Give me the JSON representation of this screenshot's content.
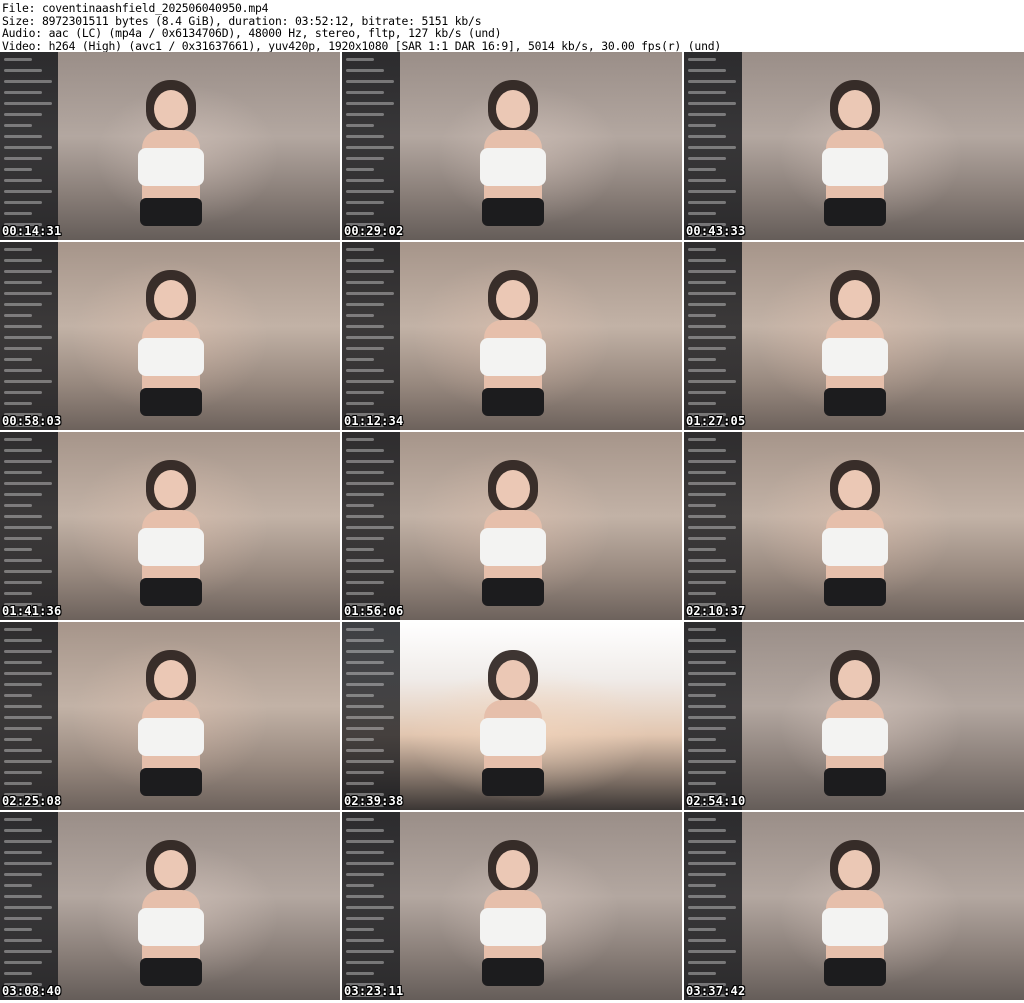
{
  "header": {
    "file_line": "File: coventinaashfield_202506040950.mp4",
    "size_line": "Size: 8972301511 bytes (8.4 GiB), duration: 03:52:12, bitrate: 5151 kb/s",
    "audio_line": "Audio: aac (LC) (mp4a / 0x6134706D), 48000 Hz, stereo, fltp, 127 kb/s (und)",
    "video_line": "Video: h264 (High) (avc1 / 0x31637661), yuv420p, 1920x1080 [SAR 1:1 DAR 16:9], 5014 kb/s, 30.00 fps(r) (und)"
  },
  "thumbnails": [
    {
      "time": "00:14:31",
      "variant": "alt",
      "overlay": true
    },
    {
      "time": "00:29:02",
      "variant": "alt",
      "overlay": true
    },
    {
      "time": "00:43:33",
      "variant": "alt",
      "overlay": true
    },
    {
      "time": "00:58:03",
      "variant": "warm",
      "overlay": true
    },
    {
      "time": "01:12:34",
      "variant": "warm",
      "overlay": true
    },
    {
      "time": "01:27:05",
      "variant": "warm",
      "overlay": true
    },
    {
      "time": "01:41:36",
      "variant": "warm",
      "overlay": true
    },
    {
      "time": "01:56:06",
      "variant": "warm",
      "overlay": true
    },
    {
      "time": "02:10:37",
      "variant": "warm",
      "overlay": true
    },
    {
      "time": "02:25:08",
      "variant": "warm",
      "overlay": true
    },
    {
      "time": "02:39:38",
      "variant": "close",
      "overlay": true
    },
    {
      "time": "02:54:10",
      "variant": "alt",
      "overlay": true
    },
    {
      "time": "03:08:40",
      "variant": "alt",
      "overlay": true
    },
    {
      "time": "03:23:11",
      "variant": "alt",
      "overlay": true
    },
    {
      "time": "03:37:42",
      "variant": "alt",
      "overlay": true
    }
  ]
}
